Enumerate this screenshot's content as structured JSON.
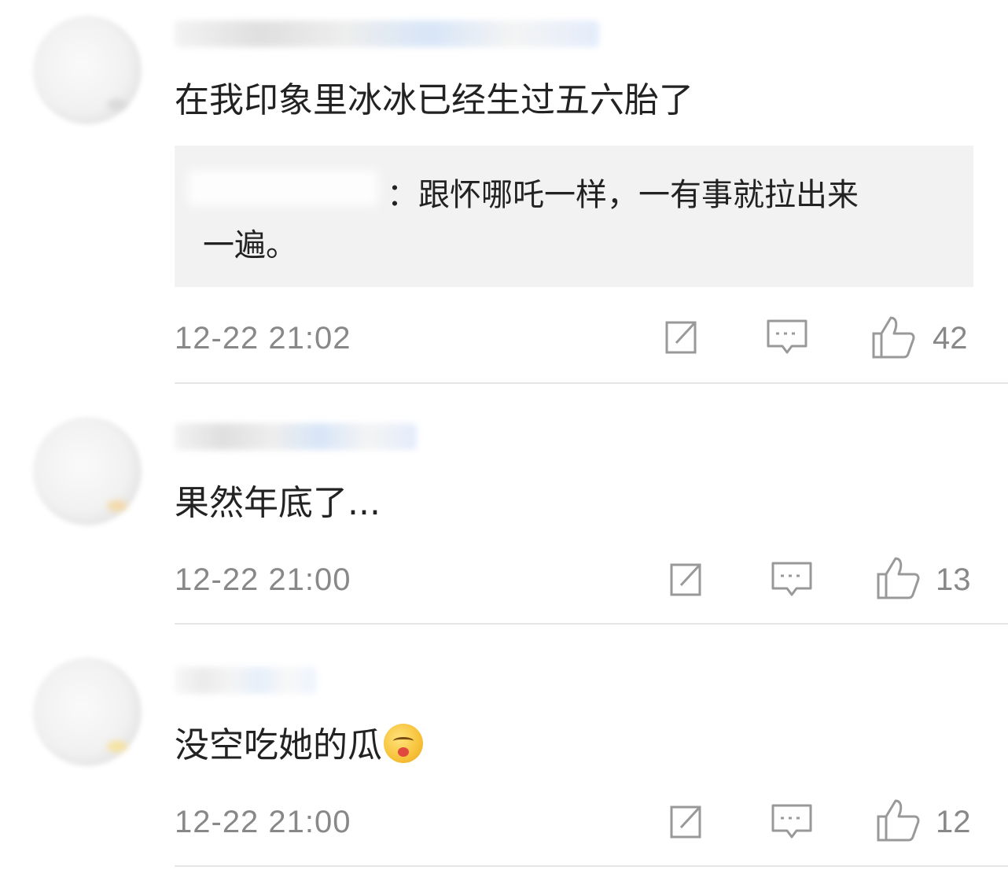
{
  "comments": [
    {
      "text": "在我印象里冰冰已经生过五六胎了",
      "reply": {
        "text_line1": "：跟怀哪吒一样，一有事就拉出来",
        "text_line2": "一遍。"
      },
      "time": "12-22  21:02",
      "likes": "42"
    },
    {
      "text": "果然年底了...",
      "time": "12-22  21:00",
      "likes": "13"
    },
    {
      "text": "没空吃她的瓜",
      "emoji": "yummy-face-emoji",
      "time": "12-22  21:00",
      "likes": "12"
    }
  ],
  "icons": {
    "repost": "share-icon",
    "comment": "comment-icon",
    "like": "thumbs-up-icon"
  },
  "colors": {
    "text": "#222222",
    "meta": "#888888",
    "quote_bg": "#f2f2f2",
    "divider": "#e6e6e6"
  }
}
